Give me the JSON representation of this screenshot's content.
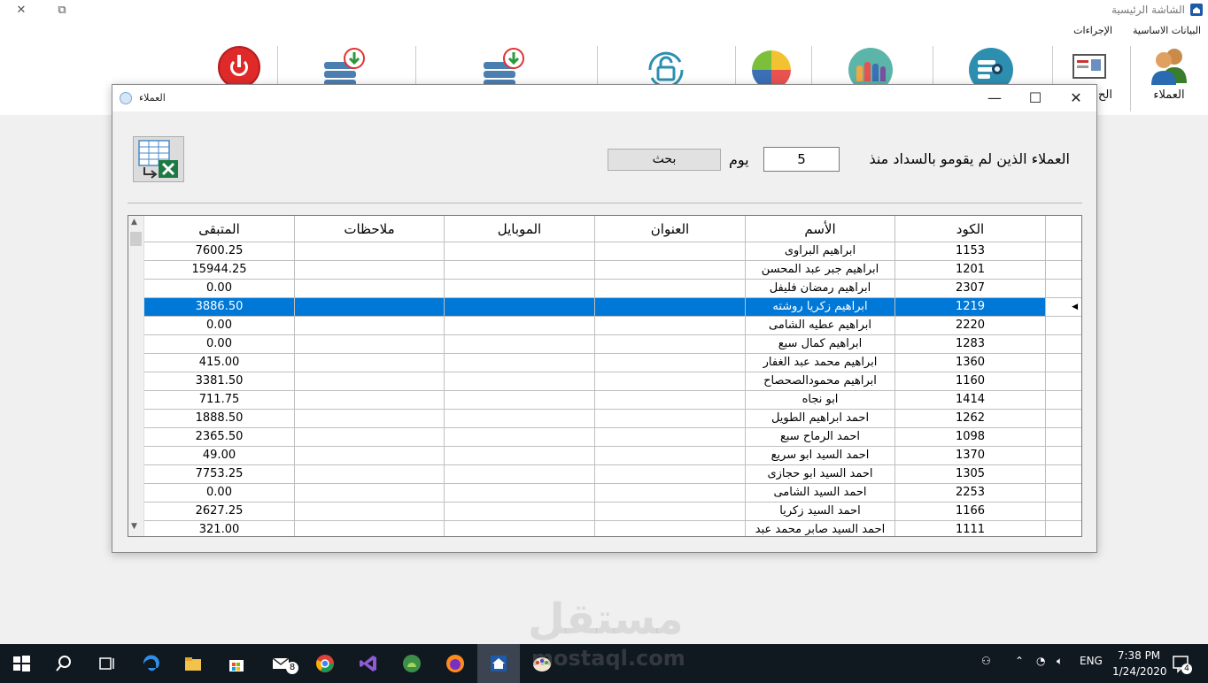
{
  "main_window": {
    "title": "الشاشة الرئيسية",
    "menu": [
      "البيانات الاساسية",
      "الإجراءات"
    ],
    "toolbar": {
      "customers_label": "العملاء",
      "partial_label": "الح"
    }
  },
  "dialog": {
    "title": "العملاء",
    "criteria_label": "العملاء الذين لم يقومو بالسداد منذ",
    "days_value": "5",
    "day_word": "يوم",
    "search_label": "بحث",
    "columns": [
      "الكود",
      "الأسم",
      "العنوان",
      "الموبايل",
      "ملاحظات",
      "المتبقى"
    ],
    "rows": [
      {
        "code": "1153",
        "name": "ابراهيم البراوى",
        "address": "",
        "mobile": "",
        "notes": "",
        "remaining": "7600.25"
      },
      {
        "code": "1201",
        "name": "ابراهيم جبر عبد المحسن",
        "address": "",
        "mobile": "",
        "notes": "",
        "remaining": "15944.25"
      },
      {
        "code": "2307",
        "name": "ابراهيم رمضان فليفل",
        "address": "",
        "mobile": "",
        "notes": "",
        "remaining": "0.00"
      },
      {
        "code": "1219",
        "name": "ابراهيم زكريا روشته",
        "address": "",
        "mobile": "",
        "notes": "",
        "remaining": "3886.50",
        "selected": true
      },
      {
        "code": "2220",
        "name": "ابراهيم عطيه الشامى",
        "address": "",
        "mobile": "",
        "notes": "",
        "remaining": "0.00"
      },
      {
        "code": "1283",
        "name": "ابراهيم كمال سبع",
        "address": "",
        "mobile": "",
        "notes": "",
        "remaining": "0.00"
      },
      {
        "code": "1360",
        "name": "ابراهيم محمد عبد الغفار",
        "address": "",
        "mobile": "",
        "notes": "",
        "remaining": "415.00"
      },
      {
        "code": "1160",
        "name": "ابراهيم محمودالصحصاح",
        "address": "",
        "mobile": "",
        "notes": "",
        "remaining": "3381.50"
      },
      {
        "code": "1414",
        "name": "ابو نجاه",
        "address": "",
        "mobile": "",
        "notes": "",
        "remaining": "711.75"
      },
      {
        "code": "1262",
        "name": "احمد ابراهيم الطويل",
        "address": "",
        "mobile": "",
        "notes": "",
        "remaining": "1888.50"
      },
      {
        "code": "1098",
        "name": "احمد الرماح سبع",
        "address": "",
        "mobile": "",
        "notes": "",
        "remaining": "2365.50"
      },
      {
        "code": "1370",
        "name": "احمد السيد ابو سريع",
        "address": "",
        "mobile": "",
        "notes": "",
        "remaining": "49.00"
      },
      {
        "code": "1305",
        "name": "احمد السيد ابو حجازى",
        "address": "",
        "mobile": "",
        "notes": "",
        "remaining": "7753.25"
      },
      {
        "code": "2253",
        "name": "احمد السيد الشامى",
        "address": "",
        "mobile": "",
        "notes": "",
        "remaining": "0.00"
      },
      {
        "code": "1166",
        "name": "احمد السيد زكريا",
        "address": "",
        "mobile": "",
        "notes": "",
        "remaining": "2627.25"
      },
      {
        "code": "1111",
        "name": "احمد السيد صابر محمد عبد",
        "address": "",
        "mobile": "",
        "notes": "",
        "remaining": "321.00"
      }
    ]
  },
  "watermark": {
    "arabic": "مستقل",
    "latin": "mostaql.com"
  },
  "taskbar": {
    "mail_badge": "8",
    "language": "ENG",
    "time": "7:38 PM",
    "date": "1/24/2020",
    "notification_count": "4"
  },
  "colors": {
    "selection": "#0078d7",
    "taskbar": "#101820"
  }
}
